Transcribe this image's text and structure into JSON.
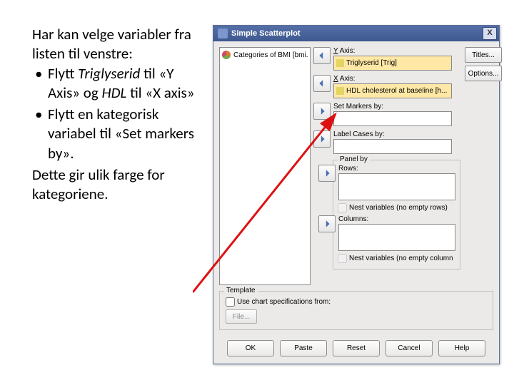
{
  "instruction": {
    "intro": "Har kan velge variabler fra listen til venstre:",
    "li1_pre": "Flytt ",
    "li1_italic": "Triglyserid",
    "li1_mid": " til «Y Axis» og ",
    "li1_italic2": "HDL",
    "li1_post": " til «X axis»",
    "li2": "Flytt en kategorisk variabel til «Set markers by».",
    "outro": "Dette gir ulik farge for kategoriene."
  },
  "dialog": {
    "title": "Simple Scatterplot",
    "close": "X",
    "source_item": "Categories of BMI [bmi...",
    "side_titles": "Titles...",
    "side_options": "Options...",
    "y_label": "Y Axis:",
    "y_value": "Triglyserid [Trig]",
    "x_label": "X Axis:",
    "x_value": "HDL cholesterol at baseline [h...",
    "setmarkers_label": "Set Markers by:",
    "labelcases_label": "Label Cases by:",
    "panel_title": "Panel by",
    "rows_label": "Rows:",
    "nest_rows": "Nest variables (no empty rows)",
    "cols_label": "Columns:",
    "nest_cols": "Nest variables (no empty column",
    "template_title": "Template",
    "template_cb": "Use chart specifications from:",
    "file_btn": "File...",
    "ok": "OK",
    "paste": "Paste",
    "reset": "Reset",
    "cancel": "Cancel",
    "help": "Help"
  }
}
